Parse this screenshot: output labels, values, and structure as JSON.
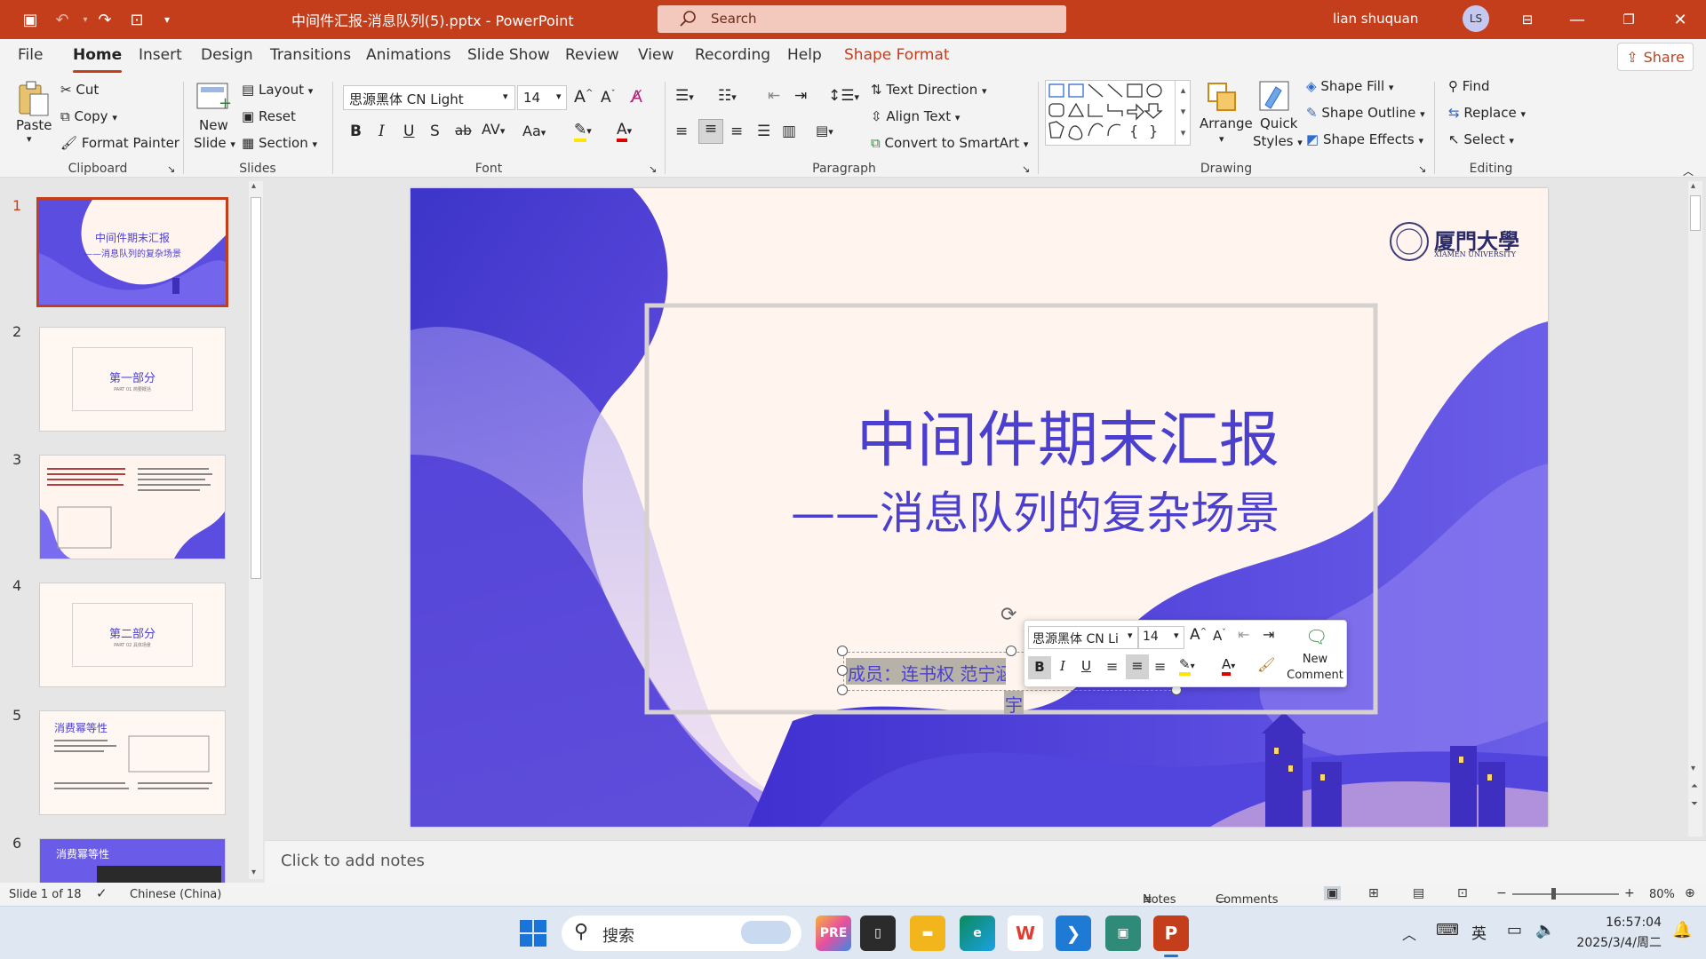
{
  "window": {
    "doc_title": "中间件汇报-消息队列(5).pptx",
    "separator": " - ",
    "app": "PowerPoint",
    "search_placeholder": "Search",
    "user": "lian shuquan",
    "initials": "LS"
  },
  "menu": [
    "File",
    "Home",
    "Insert",
    "Design",
    "Transitions",
    "Animations",
    "Slide Show",
    "Review",
    "View",
    "Recording",
    "Help",
    "Shape Format"
  ],
  "menu_active": "Home",
  "share": "Share",
  "ribbon": {
    "clipboard": {
      "paste": "Paste",
      "cut": "Cut",
      "copy": "Copy",
      "format_painter": "Format Painter",
      "label": "Clipboard"
    },
    "slides": {
      "new": "New",
      "slide": "Slide",
      "layout": "Layout",
      "reset": "Reset",
      "section": "Section",
      "label": "Slides"
    },
    "font": {
      "name": "思源黑体 CN Light",
      "size": "14",
      "label": "Font"
    },
    "paragraph": {
      "text_direction": "Text Direction",
      "align_text": "Align Text",
      "convert": "Convert to SmartArt",
      "label": "Paragraph"
    },
    "drawing": {
      "arrange": "Arrange",
      "quick": "Quick",
      "styles": "Styles",
      "fill": "Shape Fill",
      "outline": "Shape Outline",
      "effects": "Shape Effects",
      "label": "Drawing"
    },
    "editing": {
      "find": "Find",
      "replace": "Replace",
      "select": "Select",
      "label": "Editing"
    }
  },
  "thumbnails": [
    {
      "num": "1",
      "title": "中间件期末汇报",
      "sub": "——消息队列的复杂场景",
      "selected": true
    },
    {
      "num": "2",
      "title": "第一部分",
      "sub": "PART 01 简要概括"
    },
    {
      "num": "3",
      "title": "",
      "sub": ""
    },
    {
      "num": "4",
      "title": "第二部分",
      "sub": "PART 02 具体场景"
    },
    {
      "num": "5",
      "title": "消费幂等性",
      "sub": ""
    },
    {
      "num": "6",
      "title": "消费幂等性",
      "sub": ""
    }
  ],
  "slide": {
    "title": "中间件期末汇报",
    "subtitle": "——消息队列的复杂场景",
    "members": "成员：连书权 范宁涵",
    "members_tail": "宇",
    "logo_cn": "厦門大學",
    "logo_en": "XIAMEN UNIVERSITY"
  },
  "mini_toolbar": {
    "font": "思源黑体 CN Li",
    "size": "14",
    "new": "New",
    "comment": "Comment"
  },
  "notes_placeholder": "Click to add notes",
  "status": {
    "slide": "Slide 1 of 18",
    "lang": "Chinese (China)",
    "notes": "Notes",
    "comments": "Comments",
    "zoom": "80%"
  },
  "taskbar": {
    "search": "搜索",
    "ime": "英",
    "time": "16:57:04",
    "date": "2025/3/4/周二"
  },
  "colors": {
    "accent": "#c43e1c",
    "slide_title": "#4b3fcf",
    "wave": "#5a4de0"
  }
}
